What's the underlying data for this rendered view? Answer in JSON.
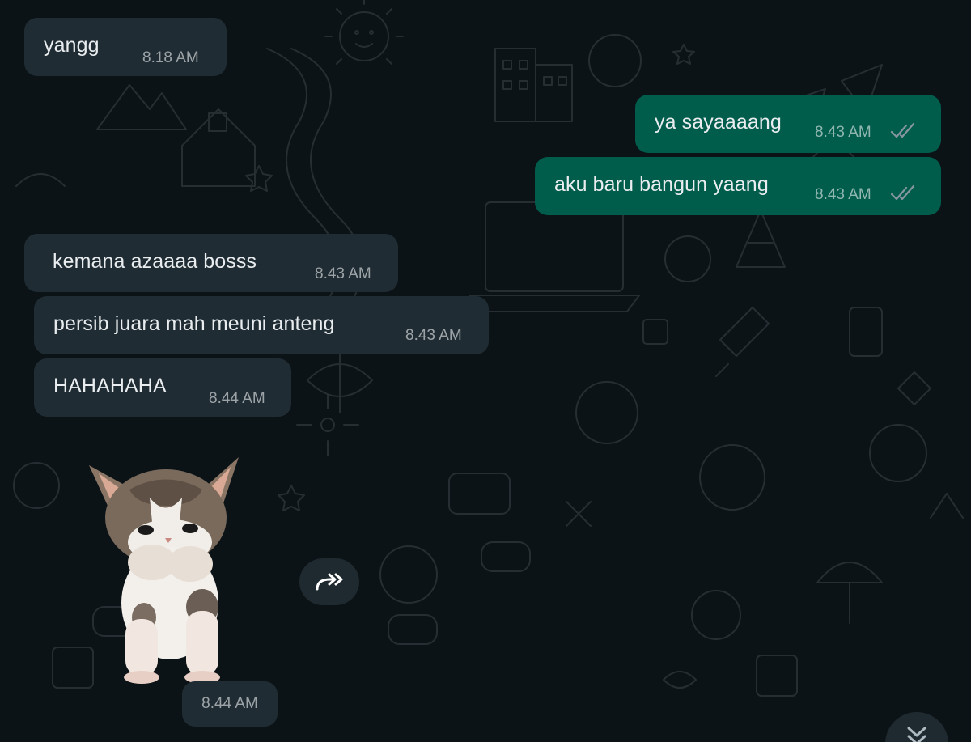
{
  "colors": {
    "background": "#0c1317",
    "incoming_bubble": "#202c33",
    "outgoing_bubble": "#005c4b",
    "text": "#e9edef",
    "read_ticks": "#8696a0"
  },
  "messages": [
    {
      "direction": "incoming",
      "text": "yangg",
      "time": "8.18 AM"
    },
    {
      "direction": "outgoing",
      "text": "ya sayaaaang",
      "time": "8.43 AM",
      "status": "read"
    },
    {
      "direction": "outgoing",
      "text": "aku baru bangun yaang",
      "time": "8.43 AM",
      "status": "read"
    },
    {
      "direction": "incoming",
      "text": "kemana azaaaa bosss",
      "time": "8.43 AM"
    },
    {
      "direction": "incoming",
      "text": "persib juara mah meuni anteng",
      "time": "8.43 AM"
    },
    {
      "direction": "incoming",
      "text": "HAHAHAHA",
      "time": "8.44 AM"
    }
  ],
  "sticker": {
    "subject": "dancing-kitten-sticker",
    "time": "8.44 AM"
  },
  "icons": {
    "forward": "forward-icon",
    "scroll_down": "chevron-double-down-icon",
    "read_receipt": "double-check-icon"
  }
}
